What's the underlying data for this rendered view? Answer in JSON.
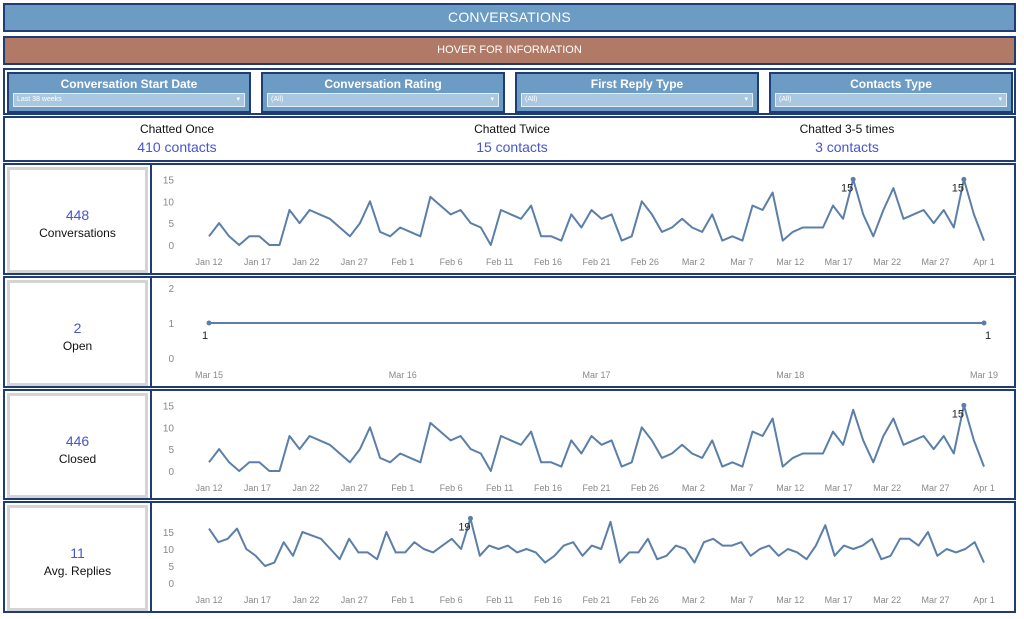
{
  "header": {
    "title": "CONVERSATIONS",
    "hover_hint": "HOVER FOR INFORMATION"
  },
  "filters": [
    {
      "label": "Conversation Start Date",
      "value": "Last 38 weeks"
    },
    {
      "label": "Conversation Rating",
      "value": "(All)"
    },
    {
      "label": "First Reply Type",
      "value": "(All)"
    },
    {
      "label": "Contacts Type",
      "value": "(All)"
    }
  ],
  "summary": [
    {
      "label": "Chatted Once",
      "value": "410 contacts"
    },
    {
      "label": "Chatted Twice",
      "value": "15 contacts"
    },
    {
      "label": "Chatted 3-5 times",
      "value": "3 contacts"
    }
  ],
  "kpis": [
    {
      "value": "448",
      "label": "Conversations"
    },
    {
      "value": "2",
      "label": "Open"
    },
    {
      "value": "446",
      "label": "Closed"
    },
    {
      "value": "11",
      "label": "Avg. Replies"
    }
  ],
  "colors": {
    "line": "#5b7fa8",
    "accent": "#4655d1",
    "border": "#1f3c77",
    "header": "#6c9cc4",
    "hover": "#b07a66"
  },
  "chart_data": [
    {
      "type": "line",
      "name": "conversations",
      "x_tick_labels": [
        "Jan 12",
        "Jan 17",
        "Jan 22",
        "Jan 27",
        "Feb 1",
        "Feb 6",
        "Feb 11",
        "Feb 16",
        "Feb 21",
        "Feb 26",
        "Mar 2",
        "Mar 7",
        "Mar 12",
        "Mar 17",
        "Mar 22",
        "Mar 27",
        "Apr 1"
      ],
      "y_ticks": [
        0,
        5,
        10,
        15
      ],
      "ylim": [
        0,
        16
      ],
      "x_start": "Jan 12",
      "values": [
        2,
        5,
        2,
        0,
        2,
        2,
        0,
        0,
        8,
        5,
        8,
        7,
        6,
        4,
        2,
        5,
        10,
        3,
        2,
        4,
        3,
        2,
        11,
        9,
        7,
        8,
        5,
        4,
        0,
        8,
        7,
        6,
        9,
        2,
        2,
        1,
        7,
        4,
        8,
        6,
        7,
        1,
        2,
        10,
        7,
        3,
        4,
        6,
        4,
        3,
        7,
        1,
        2,
        1,
        9,
        8,
        12,
        1,
        3,
        4,
        4,
        4,
        9,
        6,
        15,
        7,
        2,
        8,
        13,
        6,
        7,
        8,
        5,
        8,
        4,
        15,
        7,
        1
      ],
      "data_labels": [
        "15",
        "15"
      ]
    },
    {
      "type": "line",
      "name": "open",
      "x_tick_labels": [
        "Mar 15",
        "Mar 16",
        "Mar 17",
        "Mar 18",
        "Mar 19"
      ],
      "y_ticks": [
        0,
        1,
        2
      ],
      "ylim": [
        0,
        2
      ],
      "x": [
        "Mar 15",
        "Mar 19"
      ],
      "values": [
        1,
        1
      ],
      "data_labels": [
        "1",
        "1"
      ]
    },
    {
      "type": "line",
      "name": "closed",
      "x_tick_labels": [
        "Jan 12",
        "Jan 17",
        "Jan 22",
        "Jan 27",
        "Feb 1",
        "Feb 6",
        "Feb 11",
        "Feb 16",
        "Feb 21",
        "Feb 26",
        "Mar 2",
        "Mar 7",
        "Mar 12",
        "Mar 17",
        "Mar 22",
        "Mar 27",
        "Apr 1"
      ],
      "y_ticks": [
        0,
        5,
        10,
        15
      ],
      "ylim": [
        0,
        16
      ],
      "x_start": "Jan 12",
      "values": [
        2,
        5,
        2,
        0,
        2,
        2,
        0,
        0,
        8,
        5,
        8,
        7,
        6,
        4,
        2,
        5,
        10,
        3,
        2,
        4,
        3,
        2,
        11,
        9,
        7,
        8,
        5,
        4,
        0,
        8,
        7,
        6,
        9,
        2,
        2,
        1,
        7,
        4,
        8,
        6,
        7,
        1,
        2,
        10,
        7,
        3,
        4,
        6,
        4,
        3,
        7,
        1,
        2,
        1,
        9,
        8,
        12,
        1,
        3,
        4,
        4,
        4,
        9,
        6,
        14,
        7,
        2,
        8,
        12,
        6,
        7,
        8,
        5,
        8,
        4,
        15,
        7,
        1
      ],
      "data_labels": [
        "15"
      ]
    },
    {
      "type": "line",
      "name": "avg_replies",
      "x_tick_labels": [
        "Jan 12",
        "Jan 17",
        "Jan 22",
        "Jan 27",
        "Feb 1",
        "Feb 6",
        "Feb 11",
        "Feb 16",
        "Feb 21",
        "Feb 26",
        "Mar 2",
        "Mar 7",
        "Mar 12",
        "Mar 17",
        "Mar 22",
        "Mar 27",
        "Apr 1"
      ],
      "y_ticks": [
        0,
        5,
        10,
        15
      ],
      "ylim": [
        0,
        20
      ],
      "x_start": "Jan 12",
      "values": [
        16,
        12,
        13,
        16,
        10,
        8,
        5,
        6,
        12,
        8,
        15,
        14,
        13,
        10,
        7,
        13,
        9,
        9,
        7,
        15,
        9,
        9,
        12,
        10,
        9,
        11,
        13,
        10,
        19,
        8,
        11,
        10,
        11,
        9,
        10,
        9,
        6,
        8,
        11,
        12,
        8,
        11,
        10,
        18,
        6,
        9,
        9,
        13,
        7,
        8,
        11,
        10,
        6,
        12,
        13,
        11,
        11,
        12,
        8,
        10,
        11,
        8,
        10,
        9,
        7,
        11,
        17,
        8,
        11,
        10,
        11,
        13,
        7,
        8,
        13,
        13,
        11,
        15,
        8,
        10,
        9,
        10,
        12,
        6
      ],
      "data_labels": [
        "19"
      ]
    }
  ]
}
